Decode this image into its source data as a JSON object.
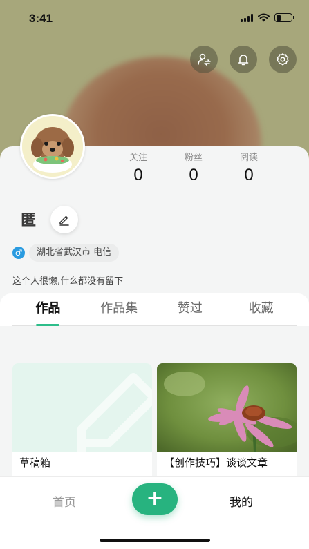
{
  "status_bar": {
    "time": "3:41"
  },
  "profile": {
    "nickname": "匿",
    "stats": [
      {
        "label": "关注",
        "value": "0"
      },
      {
        "label": "粉丝",
        "value": "0"
      },
      {
        "label": "阅读",
        "value": "0"
      }
    ],
    "gender_symbol": "♂",
    "location": "湖北省武汉市 电信",
    "bio": "这个人很懒,什么都没有留下"
  },
  "tabs": [
    {
      "label": "作品",
      "active": true
    },
    {
      "label": "作品集",
      "active": false
    },
    {
      "label": "赞过",
      "active": false
    },
    {
      "label": "收藏",
      "active": false
    }
  ],
  "cards": [
    {
      "title": "草稿箱"
    },
    {
      "title": "【创作技巧】谈谈文章"
    }
  ],
  "bottom_nav": {
    "home": "首页",
    "add": "+",
    "mine": "我的"
  },
  "colors": {
    "accent": "#27b37f",
    "cover": "#a7a77b"
  }
}
